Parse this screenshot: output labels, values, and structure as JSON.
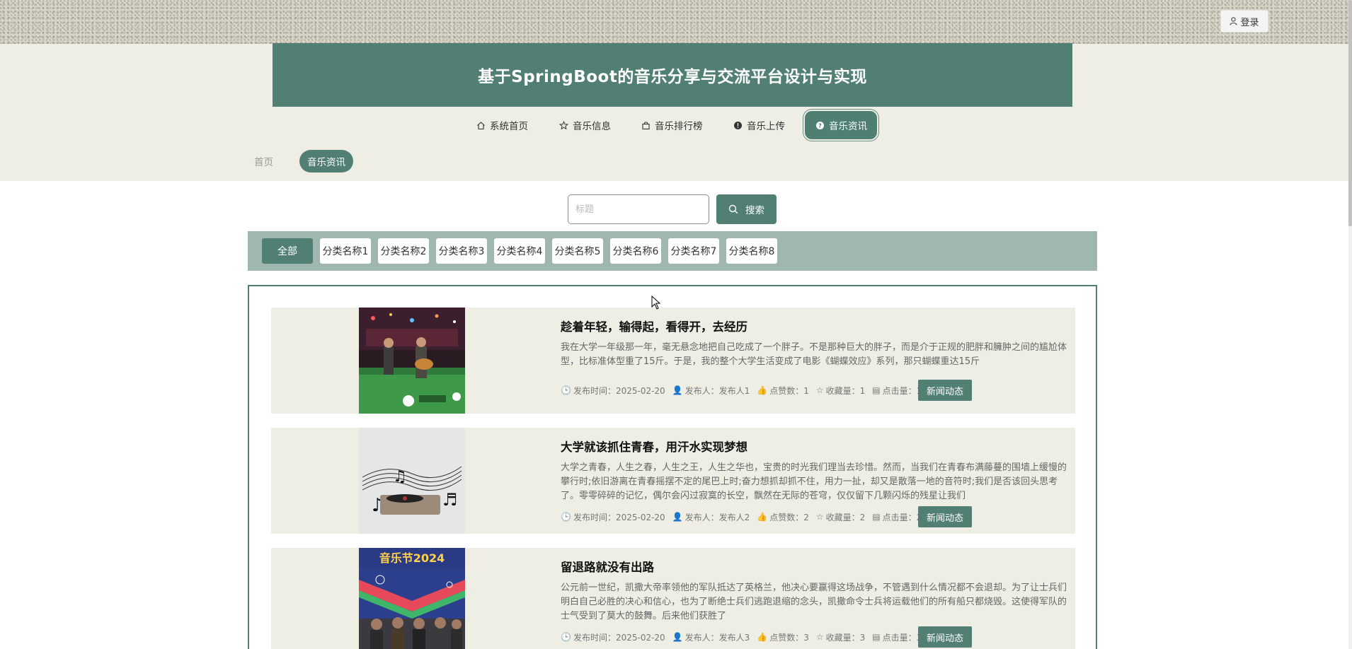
{
  "header": {
    "login_label": "登录",
    "title": "基于SpringBoot的音乐分享与交流平台设计与实现"
  },
  "nav": [
    {
      "label": "系统首页",
      "icon": "home-icon"
    },
    {
      "label": "音乐信息",
      "icon": "star-icon"
    },
    {
      "label": "音乐排行榜",
      "icon": "bag-icon"
    },
    {
      "label": "音乐上传",
      "icon": "info-circle-icon"
    },
    {
      "label": "音乐资讯",
      "icon": "question-circle-icon",
      "active": true
    }
  ],
  "breadcrumb": {
    "home": "首页",
    "current": "音乐资讯"
  },
  "search": {
    "placeholder": "标题",
    "button_label": "搜索"
  },
  "categories": [
    "全部",
    "分类名称1",
    "分类名称2",
    "分类名称3",
    "分类名称4",
    "分类名称5",
    "分类名称6",
    "分类名称7",
    "分类名称8"
  ],
  "articles": [
    {
      "title": "趁着年轻，输得起，看得开，去经历",
      "desc": "我在大学一年级那一年，毫无悬念地把自己吃成了一个胖子。不是那种巨大的胖子，而是介于正规的肥胖和臃肿之间的尴尬体型，比标准体型重了15斤。于是，我的整个大学生活变成了电影《蝴蝶效应》系列，那只蝴蝶重达15斤",
      "publish_time": "发布时间：2025-02-20",
      "publisher": "发布人：发布人1",
      "likes": "点赞数：1",
      "favorites": "收藏量：1",
      "clicks": "点击量：1",
      "tag": "新闻动态"
    },
    {
      "title": "大学就该抓住青春，用汗水实现梦想",
      "desc": "大学之青春，人生之春，人生之王，人生之华也，宝贵的时光我们理当去珍惜。然而，当我们在青春布满藤蔓的围墙上缓慢的攀行时;依旧游离在青春摇摆不定的尾巴上时;奋力想抓却抓不住，用力一扯，却又是散落一地的音符时;我们是否该回头思考了。零零碎碎的记忆，偶尔会闪过寂寞的长空，飘然在无际的苍穹，仅仅留下几颗闪烁的残星让我们",
      "publish_time": "发布时间：2025-02-20",
      "publisher": "发布人：发布人2",
      "likes": "点赞数：2",
      "favorites": "收藏量：2",
      "clicks": "点击量：2",
      "tag": "新闻动态"
    },
    {
      "title": "留退路就没有出路",
      "desc": "公元前一世纪，凯撒大帝率领他的军队抵达了英格兰，他决心要赢得这场战争，不管遇到什么情况都不会退却。为了让士兵们明白自己必胜的决心和信心，也为了断绝士兵们逃跑退缩的念头，凯撒命令士兵将运载他们的所有船只都烧毁。这使得军队的士气受到了莫大的鼓舞。后来他们获胜了",
      "publish_time": "发布时间：2025-02-20",
      "publisher": "发布人：发布人3",
      "likes": "点赞数：3",
      "favorites": "收藏量：3",
      "clicks": "点击量：3",
      "tag": "新闻动态"
    }
  ],
  "thumbnail_texts": {
    "festival_poster": "音乐节2024"
  },
  "colors": {
    "accent": "#527f73",
    "band": "#eeeee4",
    "category_bar": "#9fb7ae"
  }
}
